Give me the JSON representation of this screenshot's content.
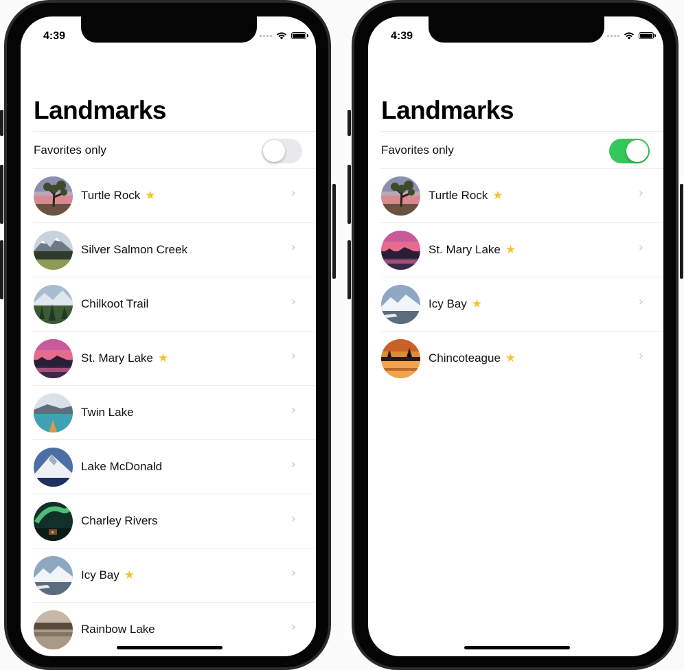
{
  "status": {
    "time": "4:39"
  },
  "title": "Landmarks",
  "filter_label": "Favorites only",
  "left": {
    "favorites_only": false,
    "rows": [
      {
        "name": "Turtle Rock",
        "favorite": true
      },
      {
        "name": "Silver Salmon Creek",
        "favorite": false
      },
      {
        "name": "Chilkoot Trail",
        "favorite": false
      },
      {
        "name": "St. Mary Lake",
        "favorite": true
      },
      {
        "name": "Twin Lake",
        "favorite": false
      },
      {
        "name": "Lake McDonald",
        "favorite": false
      },
      {
        "name": "Charley Rivers",
        "favorite": false
      },
      {
        "name": "Icy Bay",
        "favorite": true
      },
      {
        "name": "Rainbow Lake",
        "favorite": false
      }
    ]
  },
  "right": {
    "favorites_only": true,
    "rows": [
      {
        "name": "Turtle Rock",
        "favorite": true
      },
      {
        "name": "St. Mary Lake",
        "favorite": true
      },
      {
        "name": "Icy Bay",
        "favorite": true
      },
      {
        "name": "Chincoteague",
        "favorite": true
      }
    ]
  },
  "icons": {
    "star": "star-icon",
    "chevron": "chevron-right-icon",
    "wifi": "wifi-icon",
    "battery": "battery-icon",
    "signal": "signal-icon"
  },
  "colors": {
    "toggle_on": "#34c759",
    "toggle_off": "#e9e9eb",
    "star": "#f7c32f"
  }
}
